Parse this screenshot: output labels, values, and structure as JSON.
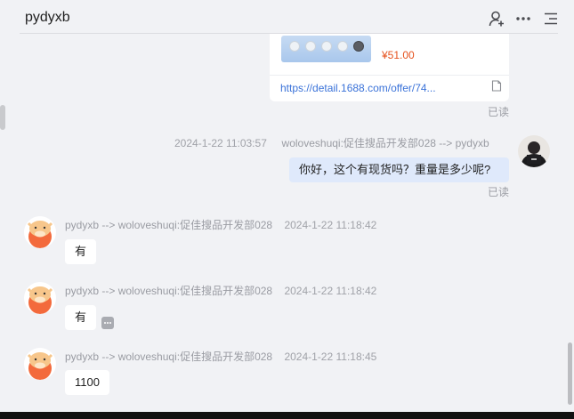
{
  "header": {
    "title": "pydyxb"
  },
  "product_card": {
    "price": "¥51.00",
    "link": "https://detail.1688.com/offer/74..."
  },
  "read_label": "已读",
  "messages": [
    {
      "time": "2024-1-22 11:03:57",
      "route": "woloveshuqi:促佳搜品开发部028 --> pydyxb",
      "text": "你好，这个有现货吗？重量是多少呢?",
      "status": "已读"
    },
    {
      "route": "pydyxb --> woloveshuqi:促佳搜品开发部028",
      "time": "2024-1-22 11:18:42",
      "text": "有"
    },
    {
      "route": "pydyxb --> woloveshuqi:促佳搜品开发部028",
      "time": "2024-1-22 11:18:42",
      "text": "有"
    },
    {
      "route": "pydyxb --> woloveshuqi:促佳搜品开发部028",
      "time": "2024-1-22 11:18:45",
      "text": "1100"
    }
  ],
  "icons": [
    "add-user-icon",
    "more-icon",
    "menu-icon",
    "copy-icon"
  ],
  "colors": {
    "price": "#e5511d",
    "link": "#3b73d9",
    "my_bubble": "#dfe9fb",
    "background": "#f1f2f5"
  }
}
